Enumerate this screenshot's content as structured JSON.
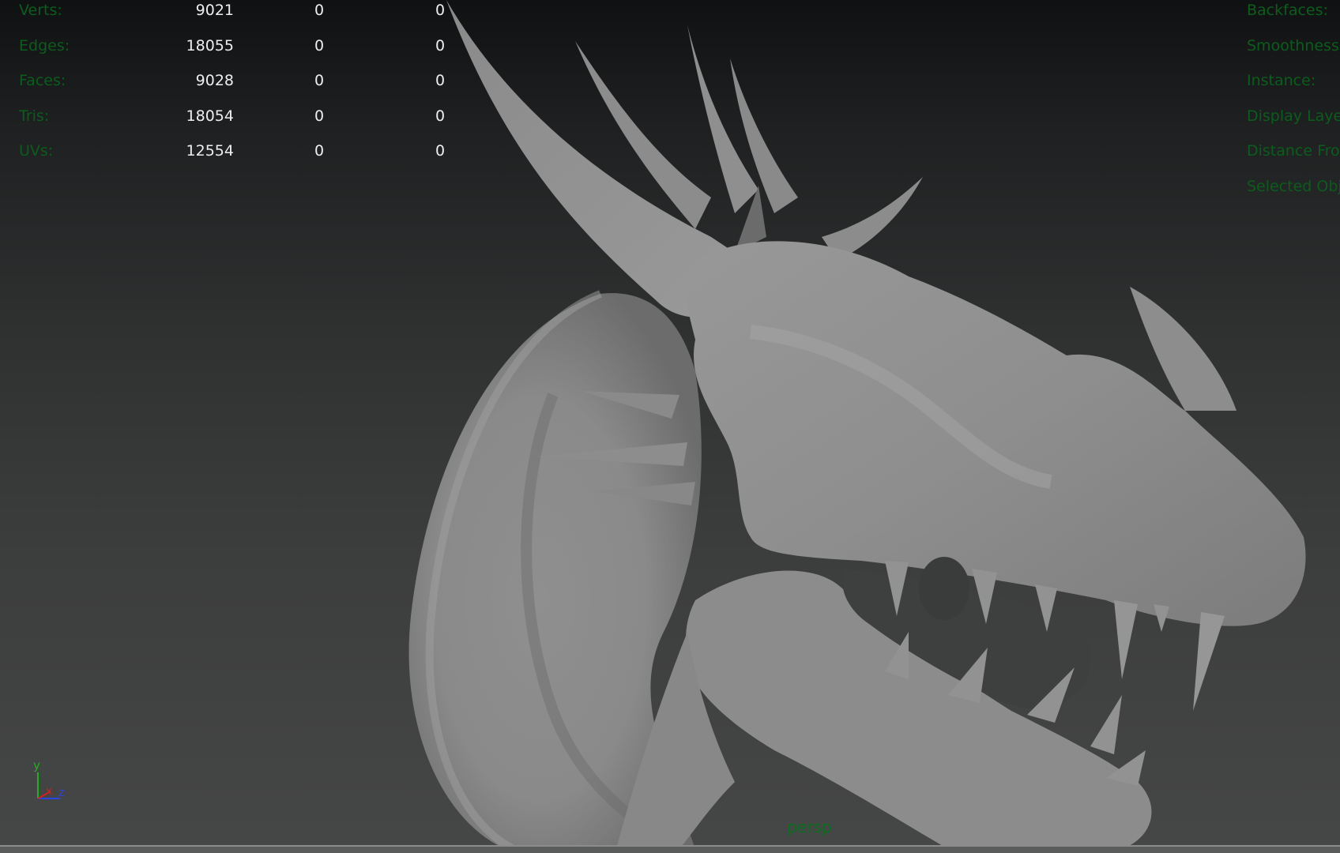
{
  "hud": {
    "rows": [
      {
        "label": "Verts:",
        "v1": "9021",
        "v2": "0",
        "v3": "0"
      },
      {
        "label": "Edges:",
        "v1": "18055",
        "v2": "0",
        "v3": "0"
      },
      {
        "label": "Faces:",
        "v1": "9028",
        "v2": "0",
        "v3": "0"
      },
      {
        "label": "Tris:",
        "v1": "18054",
        "v2": "0",
        "v3": "0"
      },
      {
        "label": "UVs:",
        "v1": "12554",
        "v2": "0",
        "v3": "0"
      }
    ],
    "right_labels": [
      "Backfaces:",
      "Smoothness:",
      "Instance:",
      "Display Layer:",
      "Distance From Camera:",
      "Selected Objects:"
    ]
  },
  "camera": {
    "name": "persp"
  },
  "axis": {
    "y": "y",
    "x": "x",
    "z": "z"
  },
  "colors": {
    "hud_label": "#0b5d1c",
    "hud_value": "#eeeeee",
    "model": "#8e8e8e",
    "axis_x": "#d22020",
    "axis_y": "#1fb21f",
    "axis_z": "#2a45e0"
  }
}
